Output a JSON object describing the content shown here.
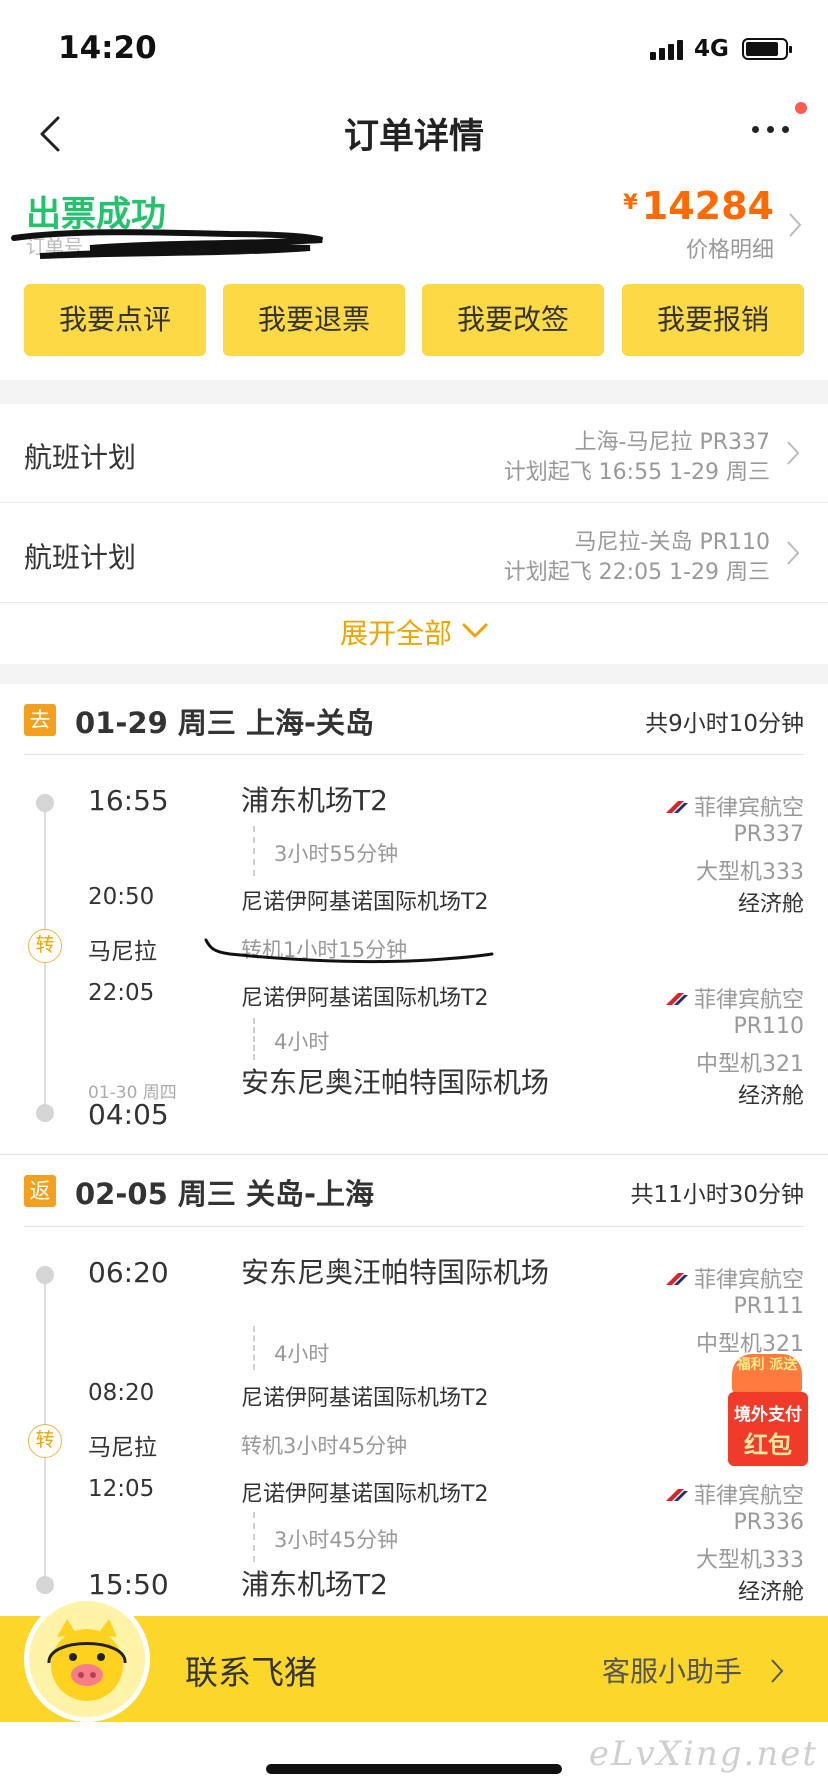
{
  "status_bar": {
    "time": "14:20",
    "network": "4G"
  },
  "nav": {
    "title": "订单详情"
  },
  "order": {
    "status": "出票成功",
    "order_no": "订单号",
    "price_currency": "¥",
    "price": "14284",
    "price_detail": "价格明细"
  },
  "actions": [
    {
      "label": "我要点评"
    },
    {
      "label": "我要退票"
    },
    {
      "label": "我要改签"
    },
    {
      "label": "我要报销"
    }
  ],
  "flight_plans": [
    {
      "label": "航班计划",
      "route": "上海-马尼拉 PR337",
      "time": "计划起飞 16:55 1-29 周三"
    },
    {
      "label": "航班计划",
      "route": "马尼拉-关岛 PR110",
      "time": "计划起飞 22:05 1-29 周三"
    }
  ],
  "expand_all": "展开全部",
  "outbound": {
    "badge": "去",
    "title": "01-29 周三 上海-关岛",
    "total": "共9小时10分钟",
    "seg1": {
      "dep_time": "16:55",
      "dep_airport": "浦东机场T2",
      "duration": "3小时55分钟",
      "arr_time": "20:50",
      "arr_airport": "尼诺伊阿基诺国际机场T2",
      "airline": "菲律宾航空",
      "flight_no": "PR337",
      "aircraft": "大型机333",
      "cabin": "经济舱"
    },
    "transfer": {
      "badge": "转",
      "city": "马尼拉",
      "note": "转机1小时15分钟"
    },
    "seg2": {
      "dep_time": "22:05",
      "dep_airport": "尼诺伊阿基诺国际机场T2",
      "duration": "4小时",
      "arr_date": "01-30 周四",
      "arr_time": "04:05",
      "arr_airport": "安东尼奥汪帕特国际机场",
      "airline": "菲律宾航空",
      "flight_no": "PR110",
      "aircraft": "中型机321",
      "cabin": "经济舱"
    }
  },
  "return": {
    "badge": "返",
    "title": "02-05 周三 关岛-上海",
    "total": "共11小时30分钟",
    "seg1": {
      "dep_time": "06:20",
      "dep_airport": "安东尼奥汪帕特国际机场",
      "duration": "4小时",
      "arr_time": "08:20",
      "arr_airport": "尼诺伊阿基诺国际机场T2",
      "airline": "菲律宾航空",
      "flight_no": "PR111",
      "aircraft": "中型机321"
    },
    "transfer": {
      "badge": "转",
      "city": "马尼拉",
      "note": "转机3小时45分钟"
    },
    "seg2": {
      "dep_time": "12:05",
      "dep_airport": "尼诺伊阿基诺国际机场T2",
      "duration": "3小时45分钟",
      "arr_time": "15:50",
      "arr_airport": "浦东机场T2",
      "airline": "菲律宾航空",
      "flight_no": "PR336",
      "aircraft": "大型机333",
      "cabin": "经济舱"
    }
  },
  "promo": {
    "top": "福利 派送",
    "line1": "境外支付",
    "line2": "红包"
  },
  "bottom": {
    "contact": "联系飞猪",
    "helper": "客服小助手"
  },
  "watermark": "eLvXing.net",
  "colors": {
    "accent_yellow": "#fcd945",
    "success_green": "#22c36c",
    "price_orange": "#ff6a00",
    "link_orange": "#f0a400"
  }
}
